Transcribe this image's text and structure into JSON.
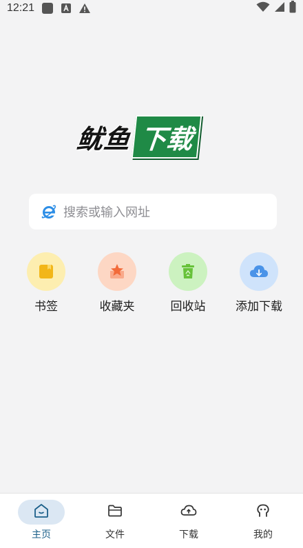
{
  "status_bar": {
    "time": "12:21",
    "left_icons": [
      "app-square-icon",
      "font-a-icon",
      "warning-icon"
    ],
    "right_icons": [
      "wifi-icon",
      "signal-icon",
      "battery-icon"
    ]
  },
  "logo": {
    "text_black": "鱿鱼",
    "text_green": "下载",
    "green_color": "#1f8a46"
  },
  "search": {
    "placeholder": "搜索或输入网址",
    "icon": "browser-e-icon"
  },
  "quick_actions": [
    {
      "label": "书签",
      "icon": "bookmark-icon",
      "bg": "#fdeeb0",
      "fg": "#f2b619"
    },
    {
      "label": "收藏夹",
      "icon": "star-box-icon",
      "bg": "#fdd7c4",
      "fg": "#f26b3a"
    },
    {
      "label": "回收站",
      "icon": "recycle-bin-icon",
      "bg": "#ccf2c0",
      "fg": "#67c23a"
    },
    {
      "label": "添加下载",
      "icon": "cloud-download-icon",
      "bg": "#cfe3fb",
      "fg": "#4a93e8"
    }
  ],
  "bottom_nav": {
    "active_color": "#1b5f89",
    "items": [
      {
        "label": "主页",
        "icon": "home-icon",
        "active": true
      },
      {
        "label": "文件",
        "icon": "folder-icon",
        "active": false
      },
      {
        "label": "下载",
        "icon": "cloud-upload-icon",
        "active": false
      },
      {
        "label": "我的",
        "icon": "profile-icon",
        "active": false
      }
    ]
  }
}
